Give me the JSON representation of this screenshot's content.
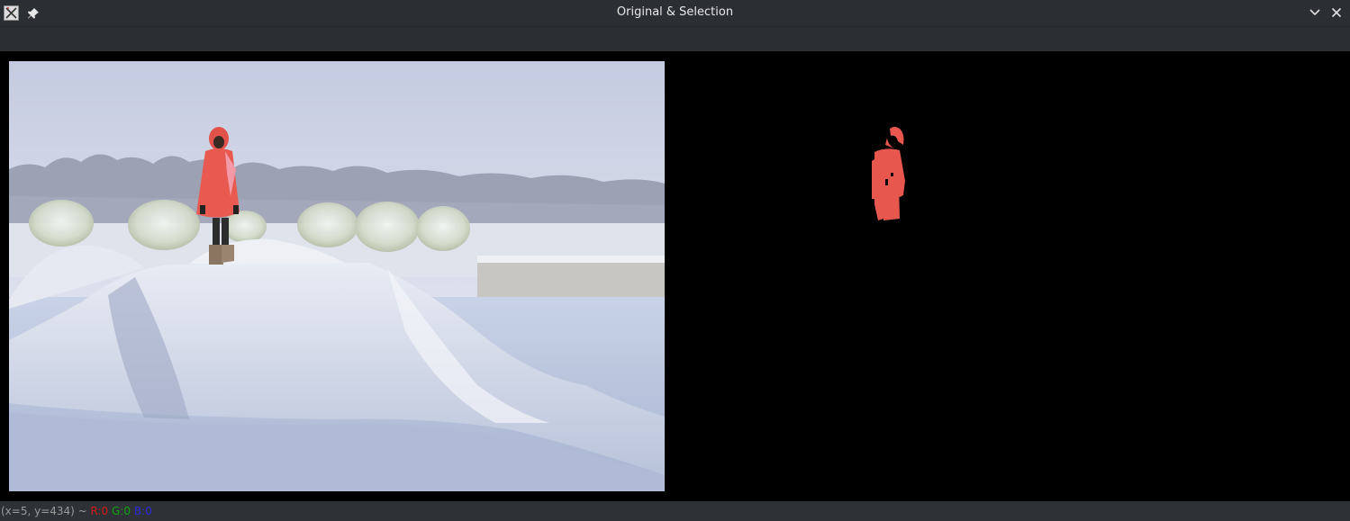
{
  "window": {
    "title": "Original & Selection"
  },
  "icons": {
    "app": "app-x-icon",
    "pin": "pin-icon",
    "minimize": "chevron-down-icon",
    "close": "close-icon"
  },
  "panels": {
    "left": {
      "content": "original snow scene photo with person in red coat"
    },
    "right": {
      "content": "selection mask showing only the red coat on black"
    }
  },
  "status": {
    "coords": "(x=5, y=434) ~ ",
    "r": "R:0",
    "g": "G:0",
    "b": "B:0"
  },
  "colors": {
    "titlebar_bg": "#2b2e33",
    "statusbar_bg": "#2e3136",
    "r_color": "#d21a1a",
    "g_color": "#12a312",
    "b_color": "#2a2ad8",
    "coat": "#e85a4f"
  }
}
